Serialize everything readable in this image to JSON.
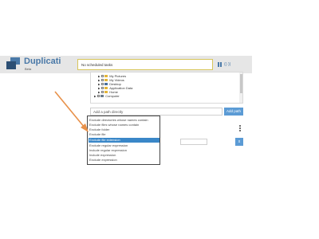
{
  "app": {
    "title": "Duplicati",
    "subtitle": "Beta"
  },
  "status": {
    "text": "No scheduled tasks"
  },
  "throttle": {
    "label": "((·))"
  },
  "tree": {
    "items": [
      {
        "label": "My Pictures",
        "expanded": false
      },
      {
        "label": "My Videos",
        "expanded": false
      },
      {
        "label": "Desktop",
        "expanded": false
      },
      {
        "label": "Application Data",
        "expanded": false
      },
      {
        "label": "Home",
        "expanded": false
      },
      {
        "label": "Computer",
        "expanded": false
      }
    ]
  },
  "path_input": {
    "placeholder": "Add a path directly"
  },
  "add_path_button": {
    "label": "Add path"
  },
  "settings_button": {
    "label": "x"
  },
  "filter_dropdown": {
    "selected_index": 5,
    "options": [
      "Exclude directories whose names contain",
      "Exclude files whose names contain",
      "Exclude folder",
      "Exclude file",
      "Exclude file extension",
      "Exclude regular expression",
      "Include regular expression",
      "Include expression",
      "Exclude expression"
    ]
  },
  "colors": {
    "accent": "#3a87c8",
    "brand": "#4a79a8",
    "annotation_arrow": "#e8914a"
  }
}
